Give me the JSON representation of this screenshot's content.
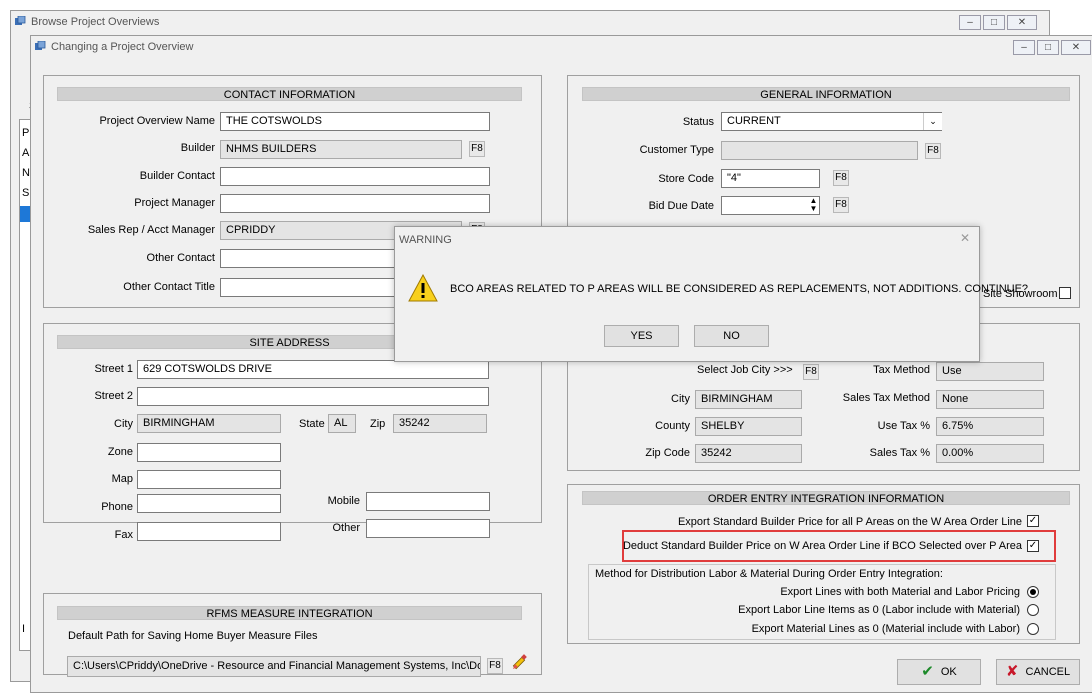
{
  "browse_window": {
    "title": "Browse Project Overviews",
    "left_fragments": [
      "S",
      "P",
      "A",
      "N",
      "S",
      "I"
    ]
  },
  "edit_window": {
    "title": "Changing a Project Overview"
  },
  "contact": {
    "header": "CONTACT INFORMATION",
    "name_label": "Project Overview Name",
    "name_value": "THE COTSWOLDS",
    "builder_label": "Builder",
    "builder_value": "NHMS BUILDERS",
    "builder_contact_label": "Builder Contact",
    "builder_contact_value": "",
    "pm_label": "Project Manager",
    "pm_value": "",
    "rep_label": "Sales Rep / Acct Manager",
    "rep_value": "CPRIDDY",
    "other_contact_label": "Other Contact",
    "other_contact_value": "",
    "other_title_label": "Other Contact Title",
    "other_title_value": ""
  },
  "site": {
    "header": "SITE ADDRESS",
    "street1_label": "Street 1",
    "street1_value": "629 COTSWOLDS DRIVE",
    "street2_label": "Street 2",
    "street2_value": "",
    "city_label": "City",
    "city_value": "BIRMINGHAM",
    "state_label": "State",
    "state_value": "AL",
    "zip_label": "Zip",
    "zip_value": "35242",
    "zone_label": "Zone",
    "map_label": "Map",
    "phone_label": "Phone",
    "fax_label": "Fax",
    "mobile_label": "Mobile",
    "other_label": "Other"
  },
  "rfms": {
    "header": "RFMS MEASURE INTEGRATION",
    "path_label": "Default Path for Saving Home Buyer Measure Files",
    "path_value": "C:\\Users\\CPriddy\\OneDrive - Resource and Financial Management Systems, Inc\\Docu"
  },
  "general": {
    "header": "GENERAL INFORMATION",
    "status_label": "Status",
    "status_value": "CURRENT",
    "customer_type_label": "Customer Type",
    "customer_type_value": "",
    "store_code_label": "Store Code",
    "store_code_value": "\"4\"",
    "bid_due_label": "Bid Due Date",
    "bid_due_value": "",
    "showroom_label": "Site Showroom"
  },
  "tax": {
    "select_city_label": "Select Job City >>>",
    "city_label": "City",
    "city_value": "BIRMINGHAM",
    "county_label": "County",
    "county_value": "SHELBY",
    "zip_label": "Zip Code",
    "zip_value": "35242",
    "tax_method_label": "Tax Method",
    "tax_method_value": "Use",
    "sales_tax_method_label": "Sales Tax Method",
    "sales_tax_method_value": "None",
    "use_tax_label": "Use Tax %",
    "use_tax_value": "6.75%",
    "sales_tax_label": "Sales Tax %",
    "sales_tax_value": "0.00%"
  },
  "order_entry": {
    "header": "ORDER ENTRY INTEGRATION INFORMATION",
    "export_std_label": "Export Standard Builder Price for all P Areas on the W Area Order Line",
    "deduct_std_label": "Deduct Standard Builder Price on W Area Order Line if BCO Selected over P Area",
    "method_label": "Method for Distribution Labor & Material During Order Entry Integration:",
    "opt1_label": "Export Lines with both Material and Labor Pricing",
    "opt2_label": "Export Labor Line Items as 0 (Labor include with Material)",
    "opt3_label": "Export Material Lines as 0 (Material include with Labor)",
    "highlight_color": "#e03c3c"
  },
  "buttons": {
    "ok_label": "OK",
    "cancel_label": "CANCEL",
    "f8_label": "F8"
  },
  "warning": {
    "title": "WARNING",
    "message": "BCO AREAS RELATED TO P AREAS WILL BE CONSIDERED AS REPLACEMENTS, NOT ADDITIONS. CONTINUE?",
    "yes_label": "YES",
    "no_label": "NO"
  }
}
